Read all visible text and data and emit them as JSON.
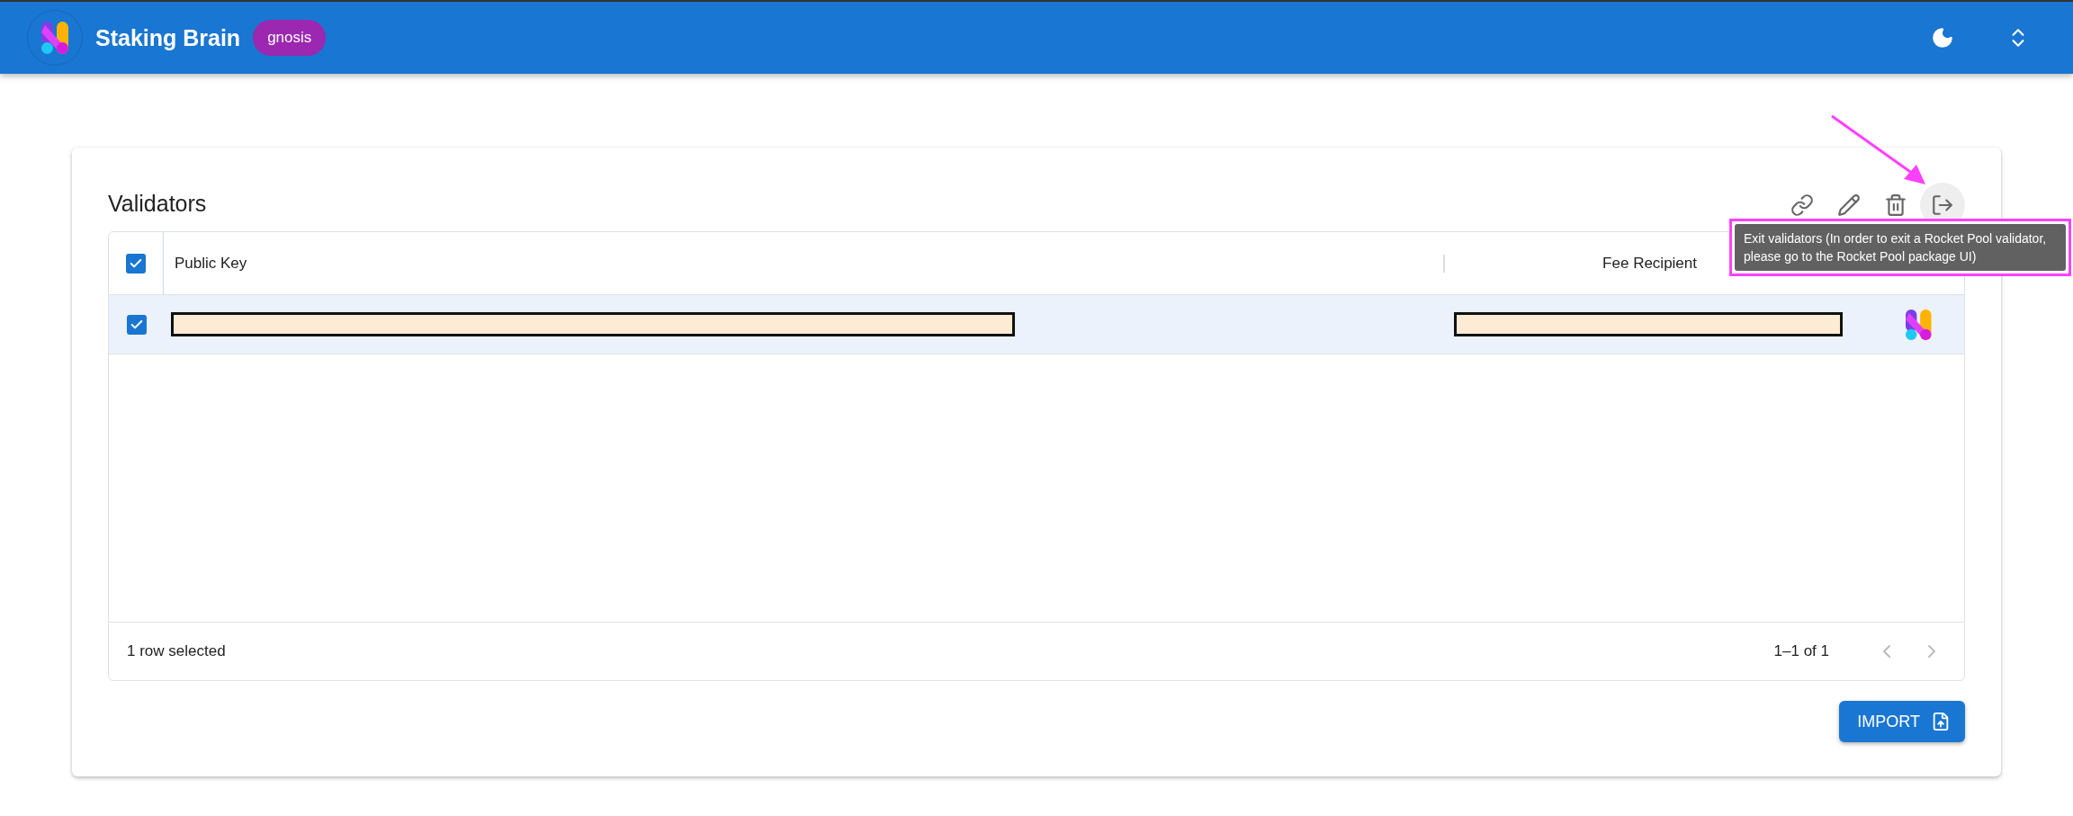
{
  "header": {
    "title": "Staking Brain",
    "network": "gnosis"
  },
  "card": {
    "title": "Validators",
    "actions": [
      {
        "kind": "link",
        "hovered": false
      },
      {
        "kind": "edit",
        "hovered": false
      },
      {
        "kind": "delete",
        "hovered": false
      },
      {
        "kind": "exit",
        "hovered": true
      }
    ],
    "tooltip": "Exit validators (In order to exit a Rocket Pool validator, please go to the Rocket Pool package UI)"
  },
  "table": {
    "all_selected": true,
    "columns": [
      "Public Key",
      "Fee Recipient"
    ],
    "rows": [
      {
        "selected": true
      }
    ],
    "footer": {
      "selection": "1 row selected",
      "range": "1–1 of 1",
      "prev_disabled": true,
      "next_disabled": true
    }
  },
  "import_button": "IMPORT"
}
